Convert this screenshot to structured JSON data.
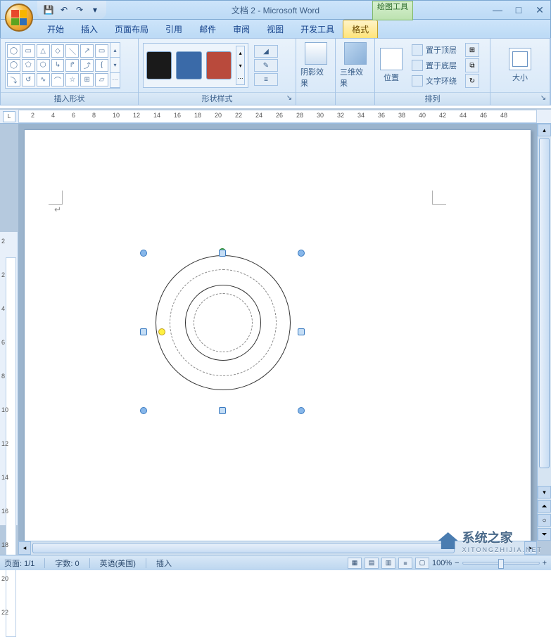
{
  "title": "文档 2 - Microsoft Word",
  "contextual_tab": "绘图工具",
  "qat": {
    "save": "💾",
    "undo": "↶",
    "redo": "↷",
    "more": "▾"
  },
  "win": {
    "min": "—",
    "max": "□",
    "close": "✕"
  },
  "tabs": {
    "start": "开始",
    "insert": "插入",
    "layout": "页面布局",
    "ref": "引用",
    "mail": "邮件",
    "review": "审阅",
    "view": "视图",
    "dev": "开发工具",
    "format": "格式"
  },
  "groups": {
    "insert_shapes": "插入形状",
    "shape_styles": "形状样式",
    "shadow": "阴影效果",
    "threed": "三维效果",
    "position": "位置",
    "arrange": "排列",
    "size": "大小"
  },
  "arrange": {
    "bring_front": "置于顶层",
    "send_back": "置于底层",
    "text_wrap": "文字环绕"
  },
  "style_side": {
    "fill": "◢",
    "outline": "✎",
    "dash": "≡"
  },
  "status": {
    "page": "页面: 1/1",
    "words": "字数: 0",
    "lang": "英语(美国)",
    "mode": "插入",
    "zoom": "100%",
    "minus": "−",
    "plus": "+"
  },
  "watermark": {
    "name": "系统之家",
    "url": "XITONGZHIJIA.NET"
  },
  "ruler_nums_h": [
    "2",
    "4",
    "6",
    "8",
    "10",
    "12",
    "14",
    "16",
    "18",
    "20",
    "22",
    "24",
    "26",
    "28",
    "30",
    "32",
    "34",
    "36",
    "38",
    "40",
    "42",
    "44",
    "46",
    "48"
  ],
  "ruler_nums_v": [
    "2",
    "2",
    "4",
    "6",
    "8",
    "10",
    "12",
    "14",
    "16",
    "18",
    "20",
    "22"
  ]
}
